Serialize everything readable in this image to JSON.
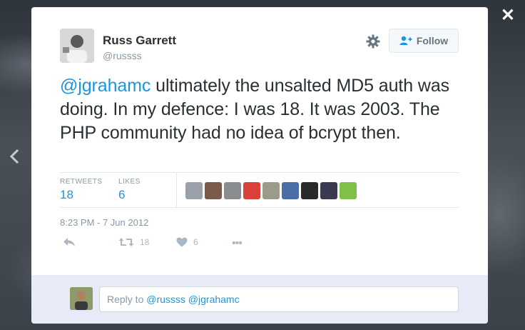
{
  "tweet": {
    "author_name": "Russ Garrett",
    "author_handle": "@russss",
    "follow_label": "Follow",
    "mention": "@jgrahamc",
    "text_rest": " ultimately the unsalted MD5 auth was doing. In my defence: I was 18. It was 2003. The PHP community had no idea of bcrypt then.",
    "timestamp": "8:23 PM - 7 Jun 2012"
  },
  "stats": {
    "retweets_label": "RETWEETS",
    "retweets_value": "18",
    "likes_label": "LIKES",
    "likes_value": "6"
  },
  "likers": [
    {
      "icon": "avatar",
      "color": "#9aa0a8"
    },
    {
      "icon": "avatar",
      "color": "#7a5a48"
    },
    {
      "icon": "avatar",
      "color": "#8a8d90"
    },
    {
      "icon": "avatar",
      "color": "#d9423a"
    },
    {
      "icon": "avatar",
      "color": "#9c9a88"
    },
    {
      "icon": "avatar",
      "color": "#4a6fa8"
    },
    {
      "icon": "avatar",
      "color": "#2a2a2a"
    },
    {
      "icon": "avatar",
      "color": "#3a3a50"
    },
    {
      "icon": "avatar",
      "color": "#7fc04a"
    }
  ],
  "actions": {
    "retweet_count": "18",
    "like_count": "6",
    "more_label": "•••"
  },
  "reply": {
    "prefix": "Reply to ",
    "mentions": "@russss @jgrahamc"
  },
  "colors": {
    "link": "#1b95e0",
    "muted": "#8899a6",
    "reply_bar": "#e8eaf8"
  }
}
